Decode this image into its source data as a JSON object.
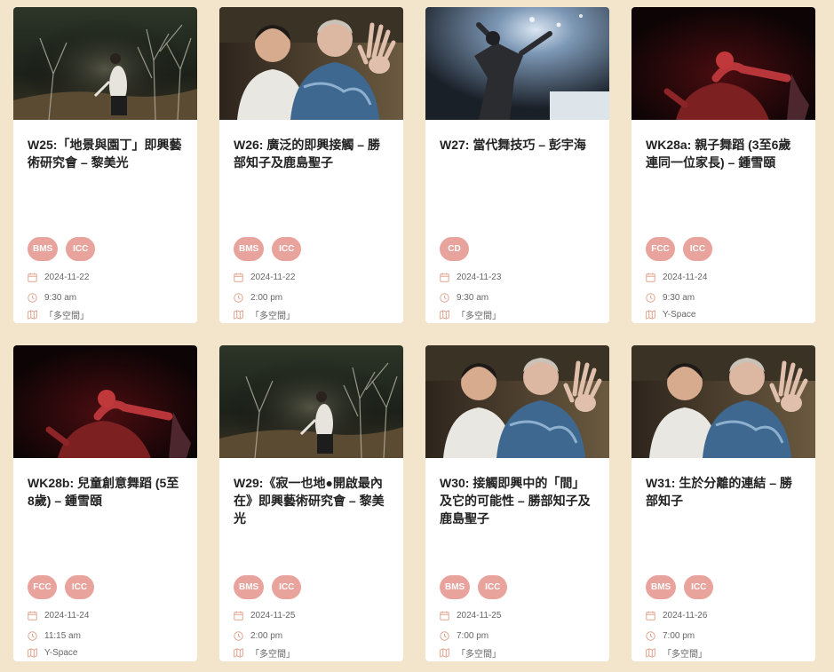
{
  "cards": [
    {
      "title": "W25:「地景與園丁」即興藝術研究會 – 黎美光",
      "tags": [
        "BMS",
        "ICC"
      ],
      "date": "2024-11-22",
      "time": "9:30 am",
      "venue": "「多空間」",
      "image": "forest-dancer"
    },
    {
      "title": "W26: 廣泛的即興接觸 – 勝部知子及鹿島聖子",
      "tags": [
        "BMS",
        "ICC"
      ],
      "date": "2024-11-22",
      "time": "2:00 pm",
      "venue": "「多空間」",
      "image": "two-women-smiling"
    },
    {
      "title": "W27: 當代舞技巧 – 彭宇海",
      "tags": [
        "CD"
      ],
      "date": "2024-11-23",
      "time": "9:30 am",
      "venue": "「多空間」",
      "image": "stage-spotlight-dancer"
    },
    {
      "title": "WK28a: 親子舞蹈 (3至6歲連同一位家長) – 鍾雪頤",
      "tags": [
        "FCC",
        "ICC"
      ],
      "date": "2024-11-24",
      "time": "9:30 am",
      "venue": "Y-Space",
      "image": "red-light-dancer"
    },
    {
      "title": "WK28b: 兒童創意舞蹈 (5至8歲) – 鍾雪頤",
      "tags": [
        "FCC",
        "ICC"
      ],
      "date": "2024-11-24",
      "time": "11:15 am",
      "venue": "Y-Space",
      "image": "red-light-dancer"
    },
    {
      "title": "W29:《寂一也地●開啟最內在》即興藝術研究會 – 黎美光",
      "tags": [
        "BMS",
        "ICC"
      ],
      "date": "2024-11-25",
      "time": "2:00 pm",
      "venue": "「多空間」",
      "image": "forest-dancer"
    },
    {
      "title": "W30: 接觸即興中的「間」及它的可能性 – 勝部知子及鹿島聖子",
      "tags": [
        "BMS",
        "ICC"
      ],
      "date": "2024-11-25",
      "time": "7:00 pm",
      "venue": "「多空間」",
      "image": "two-women-smiling"
    },
    {
      "title": "W31: 生於分離的連結 – 勝部知子",
      "tags": [
        "BMS",
        "ICC"
      ],
      "date": "2024-11-26",
      "time": "7:00 pm",
      "venue": "「多空間」",
      "image": "two-women-smiling"
    }
  ],
  "icons": {
    "date": "calendar-icon",
    "time": "clock-icon",
    "venue": "map-icon"
  },
  "colors": {
    "background": "#f3e5cc",
    "tag": "#e8a39d",
    "meta_icon": "#e0a590"
  }
}
